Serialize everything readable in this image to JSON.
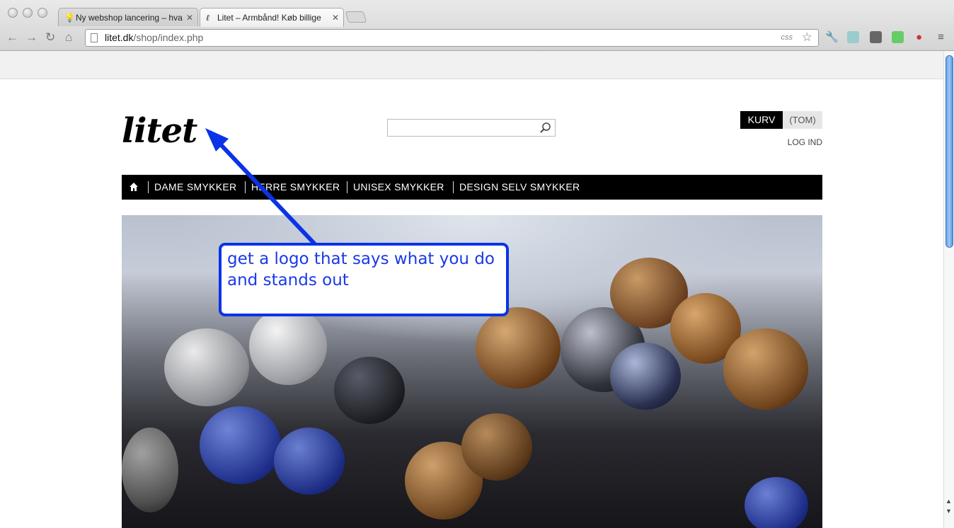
{
  "browser": {
    "tabs": [
      {
        "title": "Ny webshop lancering – hva",
        "favicon": "lightbulb-icon",
        "active": false
      },
      {
        "title": "Litet – Armbånd! Køb billige",
        "favicon": "litet-favicon",
        "active": true
      }
    ],
    "url_host": "litet.dk",
    "url_path": "/shop/index.php",
    "css_badge": "css"
  },
  "site": {
    "logo": "litet",
    "search": {
      "placeholder": "",
      "value": ""
    },
    "cart": {
      "label": "KURV",
      "status": "(TOM)"
    },
    "login": "LOG IND",
    "nav": [
      {
        "label": "DAME SMYKKER"
      },
      {
        "label": "HERRE SMYKKER"
      },
      {
        "label": "UNISEX SMYKKER"
      },
      {
        "label": "DESIGN SELV SMYKKER"
      }
    ]
  },
  "annotation": {
    "text": "get a logo that says what you do and stands out",
    "color": "#0b33e6"
  }
}
